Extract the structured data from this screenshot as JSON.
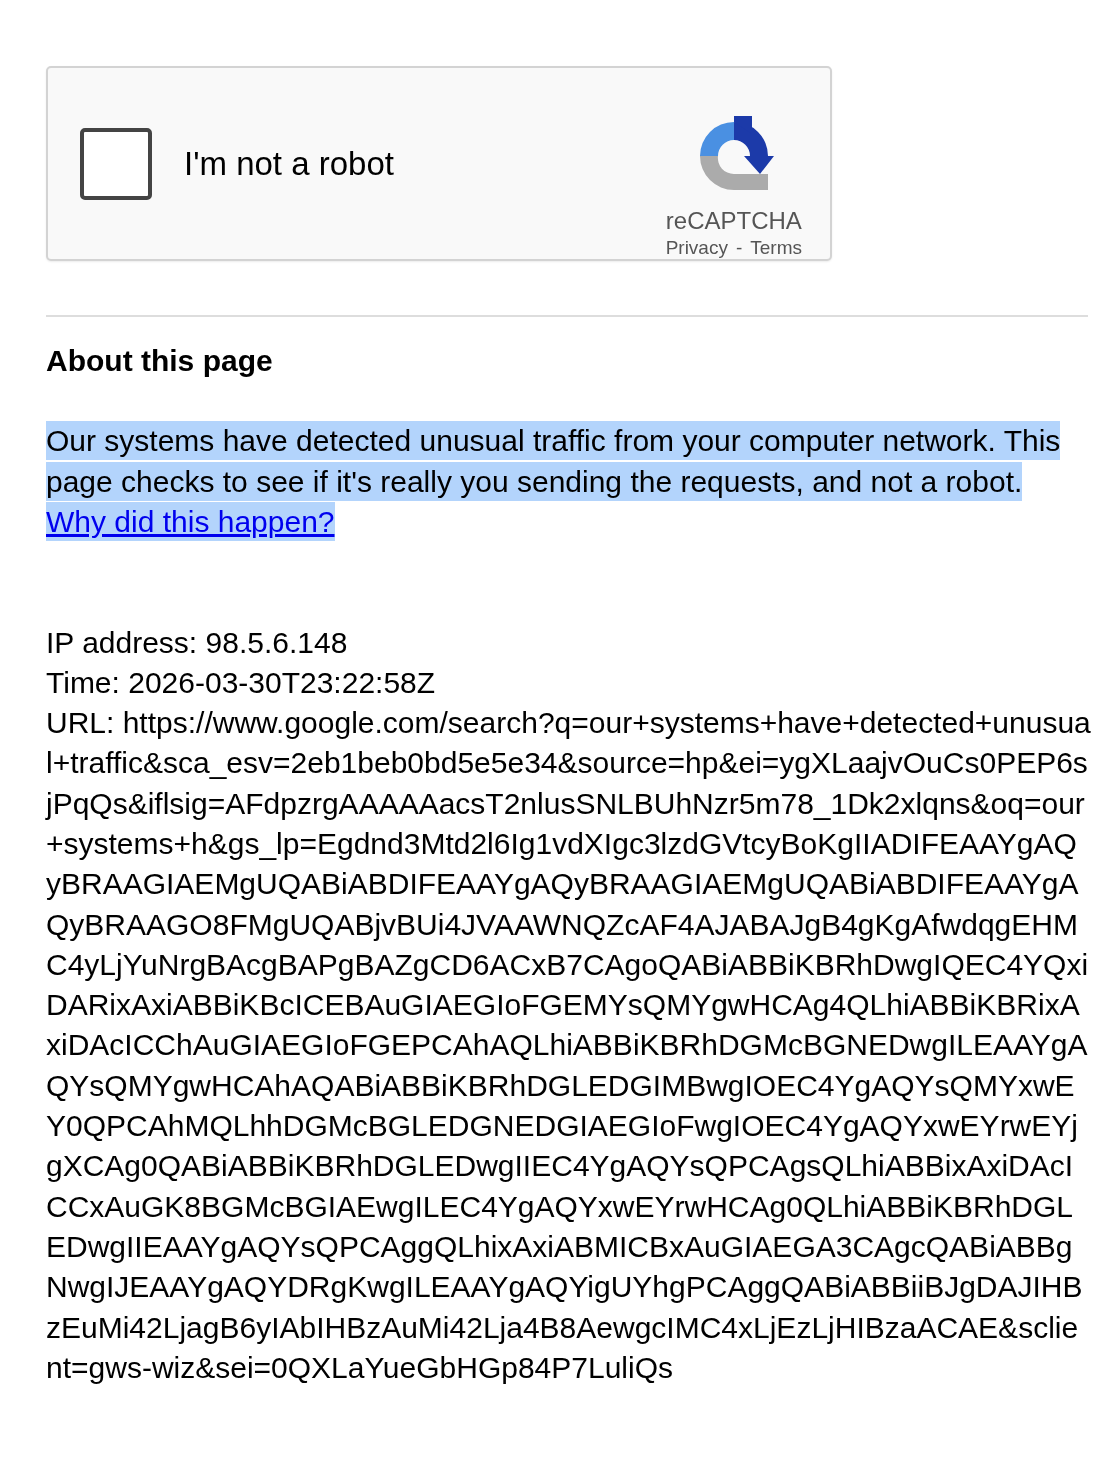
{
  "captcha": {
    "checkbox": {
      "label": "I'm not a robot",
      "checked": false
    },
    "brand": "reCAPTCHA",
    "links": [
      "Privacy",
      "Terms"
    ],
    "separator": "-"
  },
  "heading": "About this page",
  "message": {
    "text": "Our systems have detected unusual traffic from your computer network. This page checks to see if it's really you sending the requests, and not a robot.",
    "link": "Why did this happen?",
    "selected": true
  },
  "details": [
    "IP address: 98.5.6.148",
    "Time: 2026-03-30T23:22:58Z",
    "URL: https://www.google.com/search?q=our+systems+have+detected+unusual+traffic&sca_esv=2eb1beb0bd5e5e34&source=hp&ei=ygXLaajvOuCs0PEP6sjPqQs&iflsig=AFdpzrgAAAAAacsT2nlusSNLBUhNzr5m78_1Dk2xlqns&oq=our+systems+h&gs_lp=Egdnd3Mtd2l6Ig1vdXIgc3lzdGVtcyBoKgIIADIFEAAYgAQyBRAAGIAEMgUQABiABDIFEAAYgAQyBRAAGIAEMgUQABiABDIFEAAYgAQyBRAAGO8FMgUQABjvBUi4JVAAWNQZcAF4AJABAJgB4gKgAfwdqgEHMC4yLjYuNrgBAcgBAPgBAZgCD6ACxB7CAgoQABiABBiKBRhDwgIQEC4YQxiDARixAxiABBiKBcICEBAuGIAEGIoFGEMYsQMYgwHCAg4QLhiABBiKBRixAxiDAcICChAuGIAEGIoFGEPCAhAQLhiABBiKBRhDGMcBGNEDwgILEAAYgAQYsQMYgwHCAhAQABiABBiKBRhDGLEDGIMBwgIOEC4YgAQYsQMYxwEY0QPCAhMQLhhDGMcBGLEDGNEDGIAEGIoFwgIOEC4YgAQYxwEYrwEYjgXCAg0QABiABBiKBRhDGLEDwgIIEC4YgAQYsQPCAgsQLhiABBixAxiDAcICCxAuGK8BGMcBGIAEwgILEC4YgAQYxwEYrwHCAg0QLhiABBiKBRhDGLEDwgIIEAAYgAQYsQPCAggQLhixAxiABMICBxAuGIAEGA3CAgcQABiABBgNwgIJEAAYgAQYDRgKwgILEAAYgAQYigUYhgPCAggQABiABBiiBJgDAJIHBzEuMi42LjagB6yIAbIHBzAuMi42Lja4B8AewgcIMC4xLjEzLjHIBzaACAE&sclient=gws-wiz&sei=0QXLaYueGbHGp84P7LuliQs"
  ]
}
